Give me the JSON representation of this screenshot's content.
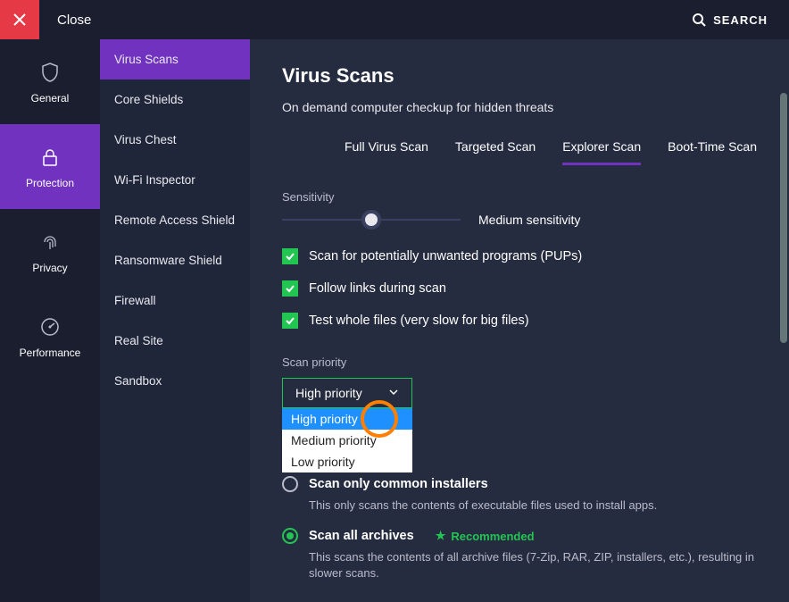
{
  "topbar": {
    "close_label": "Close",
    "search_label": "SEARCH"
  },
  "leftnav": [
    {
      "id": "general",
      "label": "General"
    },
    {
      "id": "protection",
      "label": "Protection",
      "active": true
    },
    {
      "id": "privacy",
      "label": "Privacy"
    },
    {
      "id": "performance",
      "label": "Performance"
    }
  ],
  "subnav": [
    {
      "label": "Virus Scans",
      "active": true
    },
    {
      "label": "Core Shields"
    },
    {
      "label": "Virus Chest"
    },
    {
      "label": "Wi-Fi Inspector"
    },
    {
      "label": "Remote Access Shield"
    },
    {
      "label": "Ransomware Shield"
    },
    {
      "label": "Firewall"
    },
    {
      "label": "Real Site"
    },
    {
      "label": "Sandbox"
    }
  ],
  "page": {
    "title": "Virus Scans",
    "subtitle": "On demand computer checkup for hidden threats"
  },
  "tabs": [
    {
      "label": "Full Virus Scan"
    },
    {
      "label": "Targeted Scan"
    },
    {
      "label": "Explorer Scan",
      "active": true
    },
    {
      "label": "Boot-Time Scan"
    }
  ],
  "sensitivity": {
    "label": "Sensitivity",
    "value_label": "Medium sensitivity"
  },
  "checkboxes": [
    {
      "label": "Scan for potentially unwanted programs (PUPs)",
      "checked": true
    },
    {
      "label": "Follow links during scan",
      "checked": true
    },
    {
      "label": "Test whole files (very slow for big files)",
      "checked": true
    }
  ],
  "priority": {
    "label": "Scan priority",
    "selected": "High priority",
    "options": [
      "High priority",
      "Medium priority",
      "Low priority"
    ]
  },
  "archives": {
    "radios": [
      {
        "label": "Scan only common installers",
        "desc": "This only scans the contents of executable files used to install apps.",
        "selected": false,
        "recommended": false
      },
      {
        "label": "Scan all archives",
        "desc": "This scans the contents of all archive files (7-Zip, RAR, ZIP, installers, etc.), resulting in slower scans.",
        "selected": true,
        "recommended": true,
        "recommended_label": "Recommended"
      }
    ]
  },
  "annotation": {
    "question_mark": "?"
  }
}
